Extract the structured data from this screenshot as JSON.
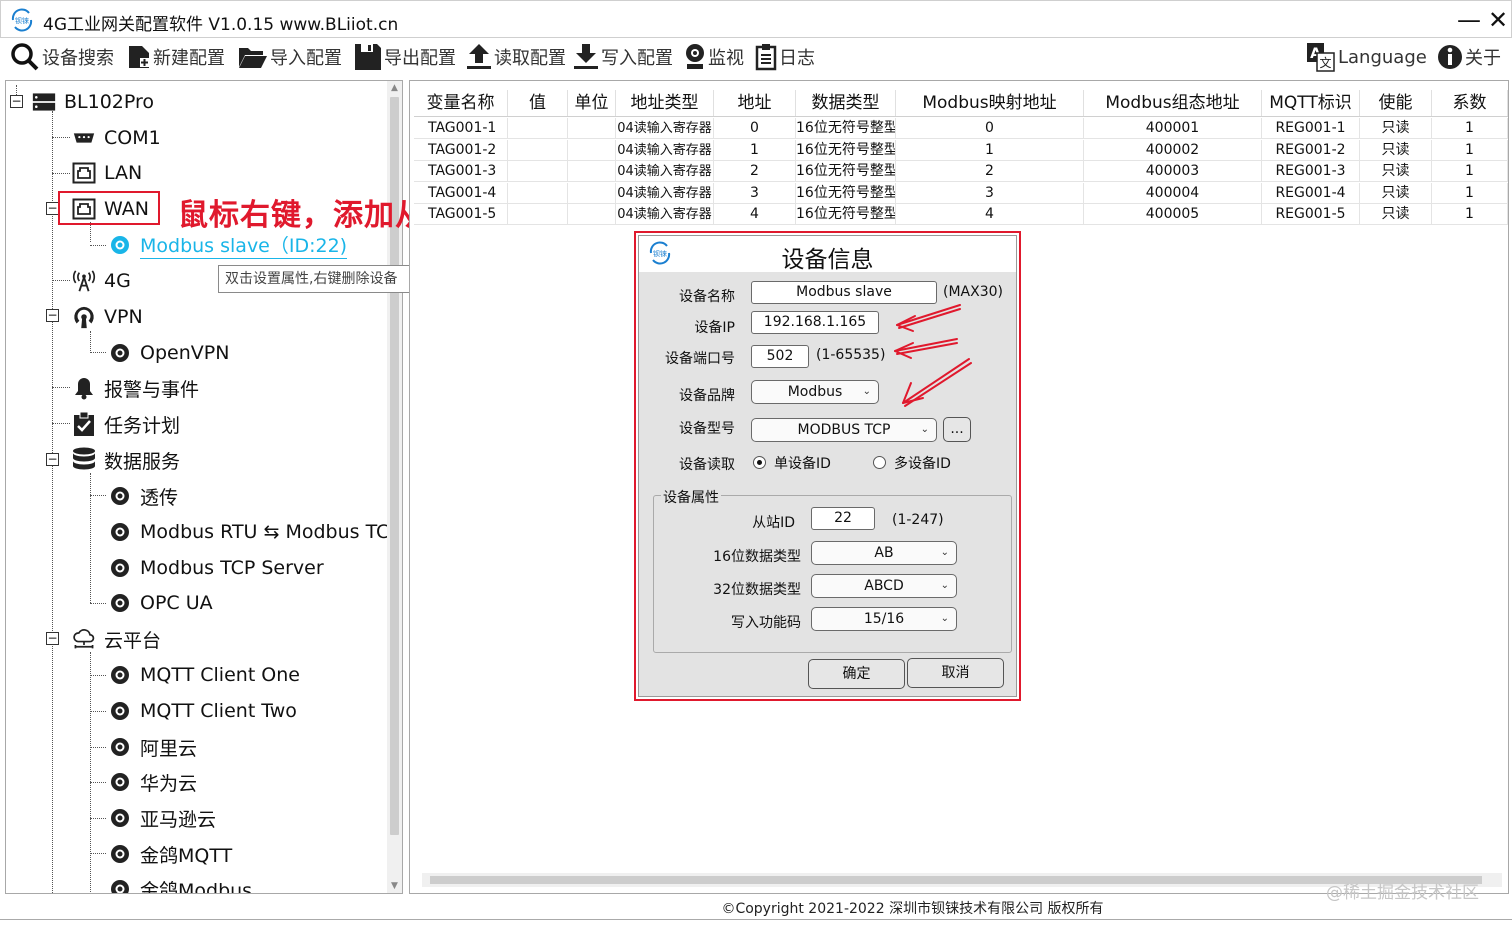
{
  "window": {
    "title": "4G工业网关配置软件 V1.0.15 www.BLiiot.cn",
    "minimize": "—",
    "close": "✕"
  },
  "toolbar": {
    "search": "设备搜索",
    "new": "新建配置",
    "import": "导入配置",
    "export": "导出配置",
    "read": "读取配置",
    "write": "写入配置",
    "monitor": "监视",
    "log": "日志",
    "language": "Language",
    "about": "关于"
  },
  "tree": {
    "root": "BL102Pro",
    "com1": "COM1",
    "lan": "LAN",
    "wan": "WAN",
    "modbus_slave": "Modbus slave（ID:22)",
    "g4": "4G",
    "vpn": "VPN",
    "openvpn": "OpenVPN",
    "alarm": "报警与事件",
    "task": "任务计划",
    "data_service": "数据服务",
    "passthrough": "透传",
    "rtu_tcp": "Modbus RTU ⇆ Modbus TCP",
    "tcp_server": "Modbus TCP Server",
    "opcua": "OPC UA",
    "cloud": "云平台",
    "mqtt1": "MQTT Client One",
    "mqtt2": "MQTT Client Two",
    "aliyun": "阿里云",
    "huawei": "华为云",
    "amazon": "亚马逊云",
    "jinge_mqtt": "金鸽MQTT",
    "jinge_modbus": "金鸽Modbus"
  },
  "annotation": "鼠标右键，添加从机",
  "tooltip": "双击设置属性,右键删除设备",
  "table": {
    "headers": [
      "变量名称",
      "值",
      "单位",
      "地址类型",
      "地址",
      "数据类型",
      "Modbus映射地址",
      "Modbus组态地址",
      "MQTT标识",
      "使能",
      "系数"
    ],
    "rows": [
      [
        "TAG001-1",
        "",
        "",
        "04读输入寄存器",
        "0",
        "16位无符号整型",
        "0",
        "400001",
        "REG001-1",
        "只读",
        "1"
      ],
      [
        "TAG001-2",
        "",
        "",
        "04读输入寄存器",
        "1",
        "16位无符号整型",
        "1",
        "400002",
        "REG001-2",
        "只读",
        "1"
      ],
      [
        "TAG001-3",
        "",
        "",
        "04读输入寄存器",
        "2",
        "16位无符号整型",
        "2",
        "400003",
        "REG001-3",
        "只读",
        "1"
      ],
      [
        "TAG001-4",
        "",
        "",
        "04读输入寄存器",
        "3",
        "16位无符号整型",
        "3",
        "400004",
        "REG001-4",
        "只读",
        "1"
      ],
      [
        "TAG001-5",
        "",
        "",
        "04读输入寄存器",
        "4",
        "16位无符号整型",
        "4",
        "400005",
        "REG001-5",
        "只读",
        "1"
      ]
    ]
  },
  "dialog": {
    "title": "设备信息",
    "name_label": "设备名称",
    "name_value": "Modbus slave",
    "name_hint": "(MAX30)",
    "ip_label": "设备IP",
    "ip_value": "192.168.1.165",
    "port_label": "设备端口号",
    "port_value": "502",
    "port_hint": "(1-65535)",
    "brand_label": "设备品牌",
    "brand_value": "Modbus",
    "model_label": "设备型号",
    "model_value": "MODBUS TCP",
    "model_more": "...",
    "read_label": "设备读取",
    "read_single": "单设备ID",
    "read_multi": "多设备ID",
    "group_title": "设备属性",
    "slave_label": "从站ID",
    "slave_value": "22",
    "slave_hint": "(1-247)",
    "type16_label": "16位数据类型",
    "type16_value": "AB",
    "type32_label": "32位数据类型",
    "type32_value": "ABCD",
    "write_label": "写入功能码",
    "write_value": "15/16",
    "ok": "确定",
    "cancel": "取消",
    "read_mode_selected": "single"
  },
  "footer": {
    "copyright": "©Copyright 2021-2022 深圳市钡铼技术有限公司 版权所有",
    "watermark": "@稀土掘金技术社区"
  },
  "colors": {
    "annotation_red": "#e0192d",
    "selected_blue": "#19b5e8"
  }
}
